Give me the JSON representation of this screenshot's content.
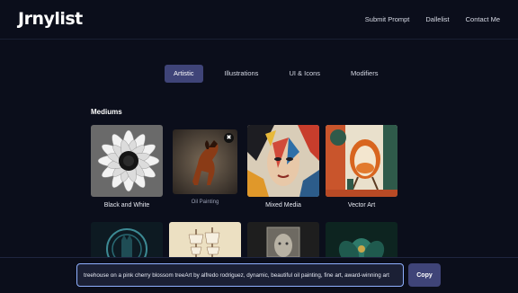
{
  "header": {
    "logo": "Jrnylist",
    "nav": [
      "Submit Prompt",
      "Dallelist",
      "Contact Me"
    ]
  },
  "tabs": [
    {
      "label": "Artistic",
      "active": true
    },
    {
      "label": "Illustrations",
      "active": false
    },
    {
      "label": "UI & Icons",
      "active": false
    },
    {
      "label": "Modifiers",
      "active": false
    }
  ],
  "section": {
    "title": "Mediums"
  },
  "cards": [
    {
      "label": "Black and White",
      "image": "white-flower-bw-image"
    },
    {
      "label": "Oil Painting",
      "image": "horse-oil-painting-image",
      "has_close": true
    },
    {
      "label": "Mixed Media",
      "image": "face-mixed-media-image"
    },
    {
      "label": "Vector Art",
      "image": "retro-chair-vector-image"
    },
    {
      "label": "",
      "image": "ornate-hand-image"
    },
    {
      "label": "",
      "image": "sailing-ship-image"
    },
    {
      "label": "",
      "image": "stone-portrait-image"
    },
    {
      "label": "",
      "image": "teal-floral-image"
    }
  ],
  "close_symbol": "✖",
  "prompt": {
    "value": "treehouse on a pink cherry blossom treeArt by alfredo rodriguez, dynamic, beautiful oil painting, fine art, award-winning art",
    "copy_label": "Copy"
  }
}
